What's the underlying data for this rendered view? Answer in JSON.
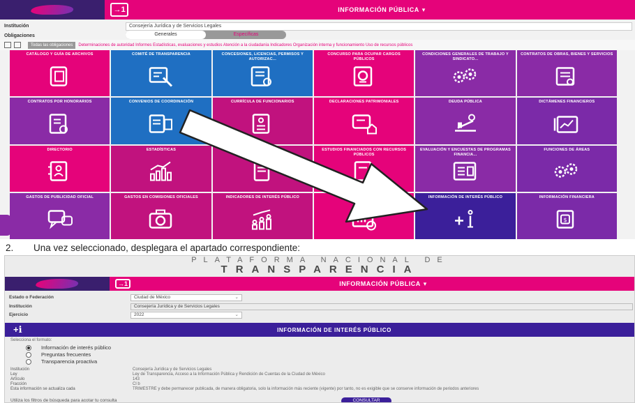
{
  "shot1": {
    "header_title": "INFORMACIÓN PÚBLICA",
    "fields": [
      {
        "label": "Institución",
        "value": "Consejería Jurídica y de Servicios Legales"
      }
    ],
    "obligaciones_label": "Obligaciones",
    "segments": [
      "Generales",
      "Específicas"
    ],
    "filter_all": "Todas las obligaciones",
    "filter_items": "Determinaciones de autoridad  Informes  Estadísticas, evaluaciones y estudios  Atención a la ciudadanía  Indicadores  Organización interna y funcionamiento  Uso de recursos públicos",
    "tiles": [
      {
        "title": "CATÁLOGO Y GUÍA DE ARCHIVOS",
        "color": "#e5037a",
        "icon": "archive-icon"
      },
      {
        "title": "COMITÉ DE TRANSPARENCIA",
        "color": "#1f6fc2",
        "icon": "gavel-icon"
      },
      {
        "title": "CONCESIONES, LICENCIAS, PERMISOS Y AUTORIZAC...",
        "color": "#1f6fc2",
        "icon": "permit-icon"
      },
      {
        "title": "CONCURSO PARA OCUPAR CARGOS PÚBLICOS",
        "color": "#e5037a",
        "icon": "search-document-icon"
      },
      {
        "title": "CONDICIONES GENERALES DE TRABAJO Y SINDICATO...",
        "color": "#8a2ba6",
        "icon": "gears-icon"
      },
      {
        "title": "CONTRATOS DE OBRAS, BIENES Y SERVICIOS",
        "color": "#8a2ba6",
        "icon": "contract-icon"
      },
      {
        "title": "CONTRATOS POR HONORARIOS",
        "color": "#8a2ba6",
        "icon": "fees-document-icon"
      },
      {
        "title": "CONVENIOS DE COORDINACIÓN",
        "color": "#1f6fc2",
        "icon": "agreement-icon"
      },
      {
        "title": "CURRÍCULA DE FUNCIONARIOS",
        "color": "#c1127e",
        "icon": "resume-icon"
      },
      {
        "title": "DECLARACIONES PATRIMONIALES",
        "color": "#e5037a",
        "icon": "assets-icon"
      },
      {
        "title": "DEUDA PÚBLICA",
        "color": "#8a2ba6",
        "icon": "balance-icon"
      },
      {
        "title": "DICTÁMENES FINANCIEROS",
        "color": "#7b2aa8",
        "icon": "financial-chart-icon"
      },
      {
        "title": "DIRECTORIO",
        "color": "#e5037a",
        "icon": "directory-icon"
      },
      {
        "title": "ESTADÍSTICAS",
        "color": "#c1127e",
        "icon": "statistics-icon"
      },
      {
        "title": "",
        "color": "#c1127e",
        "icon": "document-icon"
      },
      {
        "title": "ESTUDIOS FINANCIADOS CON RECURSOS PÚBLICOS",
        "color": "#e5037a",
        "icon": "studies-icon"
      },
      {
        "title": "EVALUACIÓN Y ENCUESTAS DE PROGRAMAS FINANCIA...",
        "color": "#8a2ba6",
        "icon": "survey-icon"
      },
      {
        "title": "FUNCIONES DE ÁREAS",
        "color": "#7b2aa8",
        "icon": "gears-icon"
      },
      {
        "title": "GASTOS DE PUBLICIDAD OFICIAL",
        "color": "#8a2ba6",
        "icon": "chat-icon"
      },
      {
        "title": "GASTOS EN COMISIONES OFICIALES",
        "color": "#c1127e",
        "icon": "camera-icon"
      },
      {
        "title": "INDICADORES DE INTERÉS PÚBLICO",
        "color": "#c1127e",
        "icon": "people-chart-icon"
      },
      {
        "title": "INDI...",
        "color": "#e5037a",
        "icon": "kpi-icon"
      },
      {
        "title": "INFORMACIÓN DE INTERÉS PÚBLICO",
        "color": "#3b1f9a",
        "icon": "plus-info-icon"
      },
      {
        "title": "INFORMACIÓN FINANCIERA",
        "color": "#7b2aa8",
        "icon": "money-document-icon"
      }
    ]
  },
  "caption": {
    "number": "2.",
    "text": "Una vez seleccionado, desplegara el apartado correspondiente:"
  },
  "shot2": {
    "banner_line1": "PLATAFORMA NACIONAL DE",
    "banner_line2": "TRANSPARENCIA",
    "header_title": "INFORMACIÓN PÚBLICA",
    "fields": [
      {
        "label": "Estado o Federación",
        "value": "Ciudad de México"
      },
      {
        "label": "Institución",
        "value": "Consejería Jurídica y de Servicios Legales"
      },
      {
        "label": "Ejercicio",
        "value": "2022"
      }
    ],
    "section_icon": "+ℹ",
    "section_title": "INFORMACIÓN DE INTERÉS PÚBLICO",
    "radio_title": "Selecciona el formato:",
    "radios": [
      {
        "label": "Información de interés público",
        "checked": true
      },
      {
        "label": "Preguntas frecuentes",
        "checked": false
      },
      {
        "label": "Transparencia proactiva",
        "checked": false
      }
    ],
    "meta": [
      {
        "key": "Institución",
        "value": "Consejería Jurídica y de Servicios Legales"
      },
      {
        "key": "Ley",
        "value": "Ley de Transparencia, Acceso a la Información Pública y Rendición de Cuentas de la Ciudad de México"
      },
      {
        "key": "Artículo",
        "value": "143"
      },
      {
        "key": "Fracción",
        "value": "Cl b"
      },
      {
        "key": "Esta información se actualiza cada",
        "value": "TRIMESTRE y debe permanecer publicada, de manera obligatoria, solo la información más reciente (vigente) por tanto, no es exigible que se conserve información de periodos anteriores"
      }
    ],
    "hint": "Utiliza los filtros de búsqueda para acotar tu consulta",
    "consult_label": "CONSULTAR"
  }
}
